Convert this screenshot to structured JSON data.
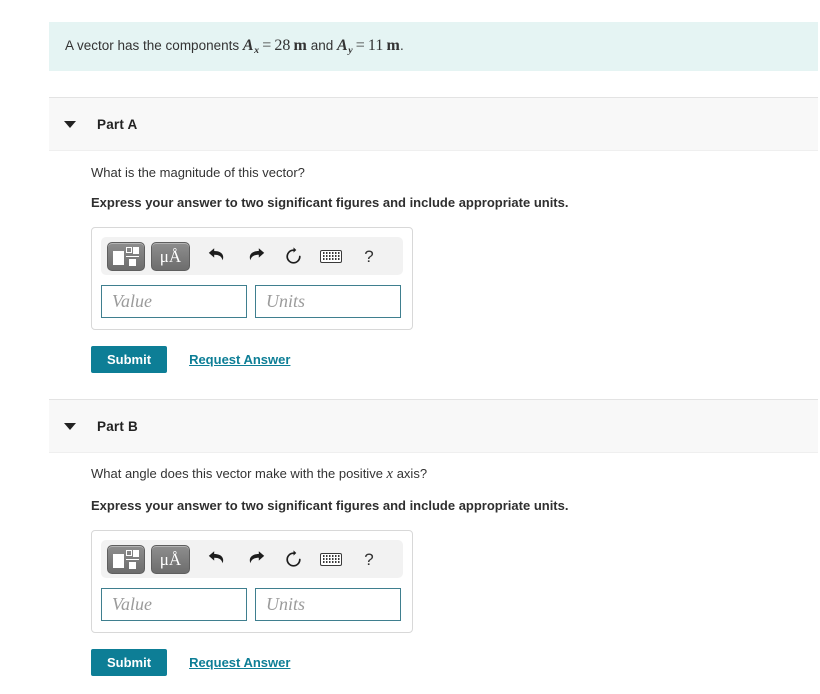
{
  "statement": {
    "prefix": "A vector has the components ",
    "vector_symbol_x": "A",
    "sub_x": "x",
    "equals": "=",
    "value_x": "28",
    "unit_x": "m",
    "conjunction": " and ",
    "vector_symbol_y": "A",
    "sub_y": "y",
    "value_y": "11",
    "unit_y": "m",
    "period": "."
  },
  "parts": [
    {
      "label": "Part A",
      "caret_icon": "chevron-down-icon",
      "question_prefix": "What is the magnitude of this vector?",
      "question_math": "",
      "question_suffix": "",
      "instruction": "Express your answer to two significant figures and include appropriate units.",
      "toolbar": {
        "template_button": "template-icon",
        "units_button": "μÅ",
        "undo_button": "undo-icon",
        "redo_button": "redo-icon",
        "reset_button": "reset-icon",
        "keyboard_button": "keyboard-icon",
        "help_button": "?"
      },
      "value_field": {
        "value": "",
        "placeholder": "Value"
      },
      "units_field": {
        "value": "",
        "placeholder": "Units"
      },
      "submit_label": "Submit",
      "request_answer_label": "Request Answer"
    },
    {
      "label": "Part B",
      "caret_icon": "chevron-down-icon",
      "question_prefix": "What angle does this vector make with the positive ",
      "question_math": "x",
      "question_suffix": " axis?",
      "instruction": "Express your answer to two significant figures and include appropriate units.",
      "toolbar": {
        "template_button": "template-icon",
        "units_button": "μÅ",
        "undo_button": "undo-icon",
        "redo_button": "redo-icon",
        "reset_button": "reset-icon",
        "keyboard_button": "keyboard-icon",
        "help_button": "?"
      },
      "value_field": {
        "value": "",
        "placeholder": "Value"
      },
      "units_field": {
        "value": "",
        "placeholder": "Units"
      },
      "submit_label": "Submit",
      "request_answer_label": "Request Answer"
    }
  ],
  "colors": {
    "banner_bg": "#e5f4f3",
    "part_header_bg": "#f8f8f8",
    "accent_teal": "#0d7e96",
    "field_border": "#3f7f8f"
  }
}
